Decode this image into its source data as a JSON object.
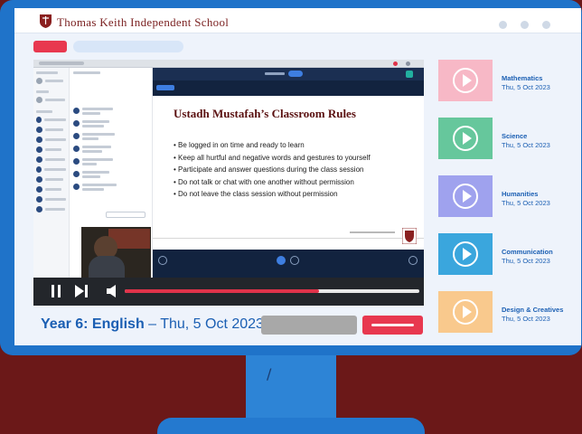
{
  "header": {
    "school_name": "Thomas Keith Independent School",
    "window_buttons": [
      "minimize",
      "maximize",
      "close"
    ]
  },
  "colors": {
    "brand_red": "#e8384f",
    "brand_blue": "#1b5fb3",
    "monitor_blue": "#1f73c9",
    "background": "#6b1818"
  },
  "lesson": {
    "year": "Year 6: English",
    "date_suffix": " – Thu, 5 Oct 2023",
    "meeting_title": "Year 6 English",
    "slide": {
      "title": "Ustadh Mustafah’s Classroom Rules",
      "rules": [
        "Be logged in on time and ready to learn",
        "Keep all hurtful and negative words and gestures to yourself",
        "Participate and answer questions during the class session",
        "Do not talk or chat with one another without permission",
        "Do not leave the class session without permission"
      ]
    }
  },
  "player": {
    "progress": 0.66,
    "icons": [
      "pause-icon",
      "skip-next-icon",
      "volume-icon"
    ]
  },
  "subjects": [
    {
      "name": "Mathematics",
      "date": "Thu, 5 Oct 2023",
      "color": "#f7b8c6"
    },
    {
      "name": "Science",
      "date": "Thu, 5 Oct 2023",
      "color": "#66c79c"
    },
    {
      "name": "Humanities",
      "date": "Thu, 5 Oct 2023",
      "color": "#9fa2ee"
    },
    {
      "name": "Communication",
      "date": "Thu, 5 Oct 2023",
      "color": "#3aa6dd"
    },
    {
      "name": "Design & Creatives",
      "date": "Thu, 5 Oct 2023",
      "color": "#f9c98d"
    }
  ]
}
